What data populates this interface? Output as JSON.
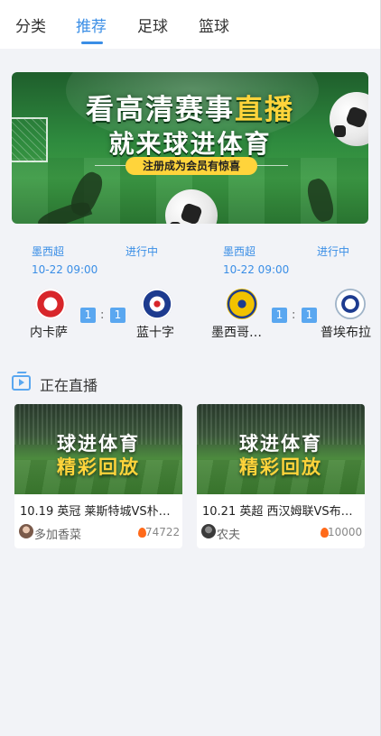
{
  "nav": {
    "tabs": [
      {
        "label": "分类"
      },
      {
        "label": "推荐",
        "active": true
      },
      {
        "label": "足球"
      },
      {
        "label": "篮球"
      }
    ]
  },
  "banner": {
    "line1_main": "看高清赛事",
    "line1_highlight": "直播",
    "line2": "就来球进体育",
    "pill": "注册成为会员有惊喜"
  },
  "matches": [
    {
      "league": "墨西超",
      "status": "进行中",
      "time": "10-22 09:00",
      "home": {
        "name": "内卡萨",
        "score": "1"
      },
      "away": {
        "name": "蓝十字",
        "score": "1"
      },
      "separator": ":"
    },
    {
      "league": "墨西超",
      "status": "进行中",
      "time": "10-22 09:00",
      "home": {
        "name": "墨西哥…",
        "score": "1"
      },
      "away": {
        "name": "普埃布拉",
        "score": "1"
      },
      "separator": ":"
    }
  ],
  "live": {
    "section_title": "正在直播",
    "cards": [
      {
        "thumb_line1": "球进体育",
        "thumb_line2": "精彩回放",
        "title": "10.19 英冠 莱斯特城VS朴茨…",
        "anchor": "多加香菜",
        "views": "74722"
      },
      {
        "thumb_line1": "球进体育",
        "thumb_line2": "精彩回放",
        "title": "10.21 英超 西汉姆联VS布伦…",
        "anchor": "农夫",
        "views": "10000"
      }
    ]
  },
  "colors": {
    "accent": "#3a8ee6",
    "score_box": "#5aa7f0",
    "highlight_yellow": "#ffd43b",
    "fire": "#ff6a1a"
  }
}
